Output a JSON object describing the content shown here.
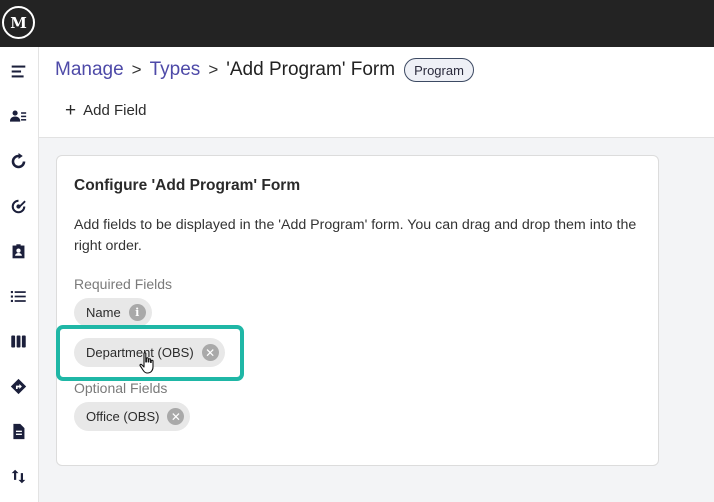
{
  "app": {
    "logo_text": "M"
  },
  "sidebar": {
    "items": [
      {
        "icon": "menu-icon"
      },
      {
        "icon": "people-list-icon"
      },
      {
        "icon": "refresh-circle-icon"
      },
      {
        "icon": "target-icon"
      },
      {
        "icon": "badge-icon"
      },
      {
        "icon": "list-icon"
      },
      {
        "icon": "columns-icon"
      },
      {
        "icon": "directions-icon"
      },
      {
        "icon": "document-icon"
      },
      {
        "icon": "swap-vertical-icon"
      }
    ]
  },
  "breadcrumb": {
    "items": [
      "Manage",
      "Types"
    ],
    "separator": ">",
    "current": "'Add Program' Form",
    "badge": "Program"
  },
  "toolbar": {
    "add_field_label": "Add Field",
    "add_field_icon": "+"
  },
  "card": {
    "title": "Configure 'Add Program' Form",
    "description": "Add fields to be displayed in the 'Add Program' form. You can drag and drop them into the right order.",
    "required_label": "Required Fields",
    "required_fields": [
      {
        "label": "Name",
        "icon": "info-icon",
        "glyph": "i"
      },
      {
        "label": "Department (OBS)",
        "icon": "remove-icon",
        "glyph": "✕"
      }
    ],
    "optional_label": "Optional Fields",
    "optional_fields": [
      {
        "label": "Office (OBS)",
        "icon": "remove-icon",
        "glyph": "✕"
      }
    ]
  },
  "colors": {
    "highlight": "#1fb7a6",
    "link": "#4e4aa8",
    "topbar": "#232323"
  }
}
